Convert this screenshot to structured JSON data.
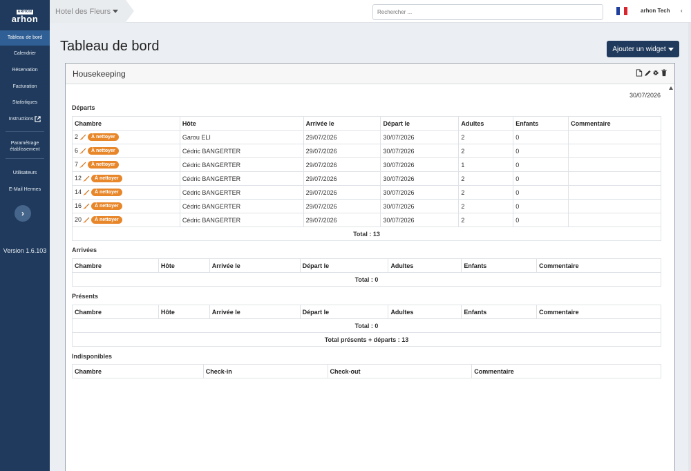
{
  "sidebar": {
    "logo_top": "ARHON",
    "logo_text": "arhon",
    "items": [
      {
        "label": "Tableau de bord",
        "name": "tableau-de-bord",
        "active": true
      },
      {
        "label": "Calendrier",
        "name": "calendrier"
      },
      {
        "label": "Réservation",
        "name": "reservation"
      },
      {
        "label": "Facturation",
        "name": "facturation"
      },
      {
        "label": "Statistiques",
        "name": "statistiques"
      },
      {
        "label": "Instructions",
        "name": "instructions",
        "external": true
      },
      {
        "label": "Paramétrage établissement",
        "name": "parametrage-etablissement"
      },
      {
        "label": "Utilisateurs",
        "name": "utilisateurs"
      },
      {
        "label": "E-Mail Hermes",
        "name": "email-hermes"
      }
    ],
    "version": "Version 1.6.103"
  },
  "topbar": {
    "hotel": "Hotel des Fleurs",
    "search_placeholder": "Rechercher ...",
    "language_flag": "fr-flag-icon",
    "user": "arhon Tech"
  },
  "page": {
    "title": "Tableau de bord",
    "add_widget": "Ajouter un widget"
  },
  "widget": {
    "title": "Housekeeping",
    "date": "30/07/2026",
    "tools": [
      "file-icon",
      "pencil-icon",
      "gear-icon",
      "trash-icon"
    ],
    "departures": {
      "title": "Départs",
      "columns": [
        "Chambre",
        "Hôte",
        "Arrivée le",
        "Départ le",
        "Adultes",
        "Enfants",
        "Commentaire"
      ],
      "rows": [
        {
          "room": "2",
          "status": "À nettoyer",
          "guest": "Garou ELI",
          "arrival": "29/07/2026",
          "departure": "30/07/2026",
          "adults": "2",
          "children": "0",
          "comment": ""
        },
        {
          "room": "6",
          "status": "À nettoyer",
          "guest": "Cédric BANGERTER",
          "arrival": "29/07/2026",
          "departure": "30/07/2026",
          "adults": "2",
          "children": "0",
          "comment": ""
        },
        {
          "room": "7",
          "status": "À nettoyer",
          "guest": "Cédric BANGERTER",
          "arrival": "29/07/2026",
          "departure": "30/07/2026",
          "adults": "1",
          "children": "0",
          "comment": ""
        },
        {
          "room": "12",
          "status": "À nettoyer",
          "guest": "Cédric BANGERTER",
          "arrival": "29/07/2026",
          "departure": "30/07/2026",
          "adults": "2",
          "children": "0",
          "comment": ""
        },
        {
          "room": "14",
          "status": "À nettoyer",
          "guest": "Cédric BANGERTER",
          "arrival": "29/07/2026",
          "departure": "30/07/2026",
          "adults": "2",
          "children": "0",
          "comment": ""
        },
        {
          "room": "16",
          "status": "À nettoyer",
          "guest": "Cédric BANGERTER",
          "arrival": "29/07/2026",
          "departure": "30/07/2026",
          "adults": "2",
          "children": "0",
          "comment": ""
        },
        {
          "room": "20",
          "status": "À nettoyer",
          "guest": "Cédric BANGERTER",
          "arrival": "29/07/2026",
          "departure": "30/07/2026",
          "adults": "2",
          "children": "0",
          "comment": ""
        }
      ],
      "total": "Total : 13"
    },
    "arrivals": {
      "title": "Arrivées",
      "columns": [
        "Chambre",
        "Hôte",
        "Arrivée le",
        "Départ le",
        "Adultes",
        "Enfants",
        "Commentaire"
      ],
      "total": "Total : 0"
    },
    "present": {
      "title": "Présents",
      "columns": [
        "Chambre",
        "Hôte",
        "Arrivée le",
        "Départ le",
        "Adultes",
        "Enfants",
        "Commentaire"
      ],
      "total": "Total : 0",
      "grand_total": "Total présents + départs : 13"
    },
    "unavailable": {
      "title": "Indisponibles",
      "columns": [
        "Chambre",
        "Check-in",
        "Check-out",
        "Commentaire"
      ]
    }
  },
  "colors": {
    "sidebar": "#1f3a5c",
    "sidebar_active": "#2f5f94",
    "badge": "#e8862a",
    "button": "#1f3a5c"
  }
}
